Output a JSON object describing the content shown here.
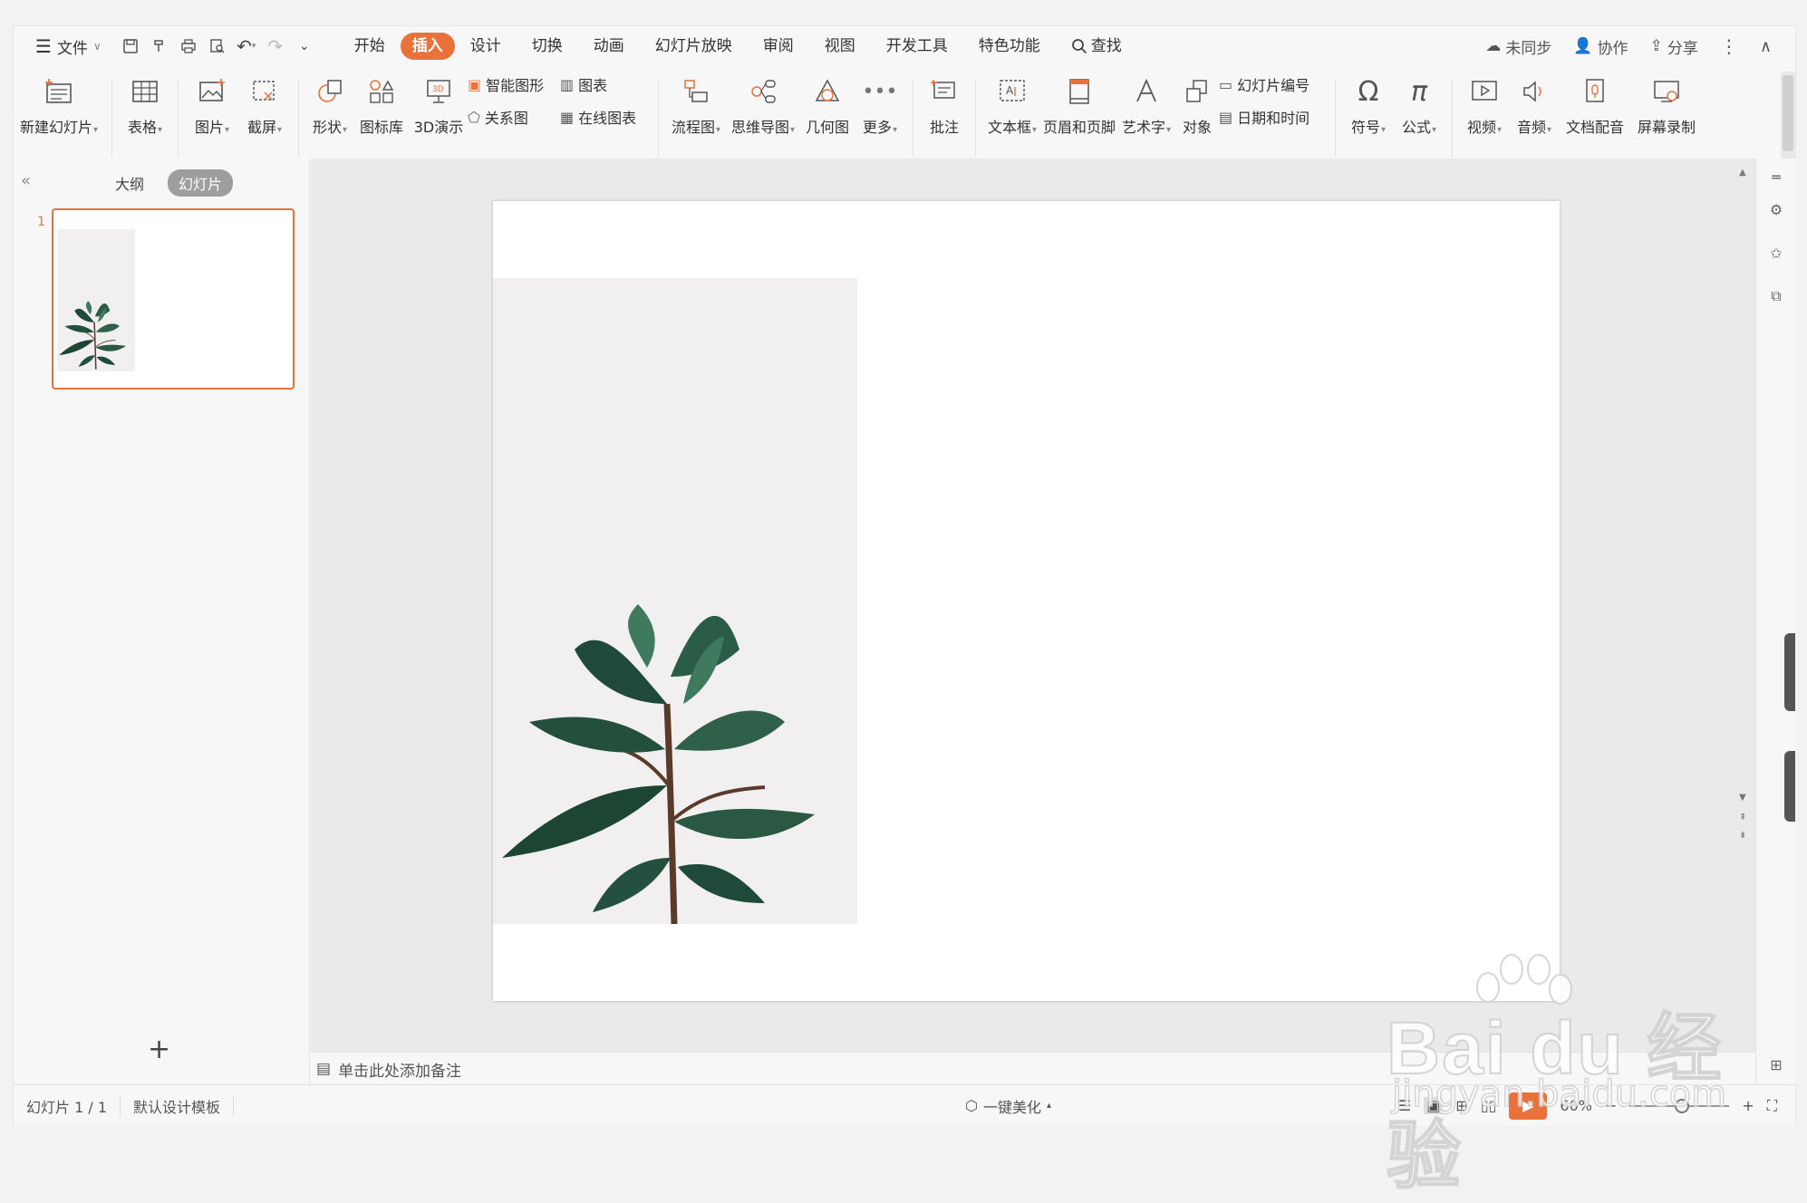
{
  "menu": {
    "file_label": "文件",
    "tabs": [
      "开始",
      "插入",
      "设计",
      "切换",
      "动画",
      "幻灯片放映",
      "审阅",
      "视图",
      "开发工具",
      "特色功能"
    ],
    "active_tab": "插入",
    "search_label": "查找",
    "right": {
      "sync": "未同步",
      "collab": "协作",
      "share": "分享"
    }
  },
  "ribbon": {
    "new_slide": "新建幻灯片",
    "table": "表格",
    "picture": "图片",
    "screenshot": "截屏",
    "shape": "形状",
    "icon_lib": "图标库",
    "demo3d": "3D演示",
    "smart_shape": "智能图形",
    "chart": "图表",
    "relation": "关系图",
    "online_chart": "在线图表",
    "flowchart": "流程图",
    "mindmap": "思维导图",
    "geometry": "几何图",
    "more": "更多",
    "comment": "批注",
    "textbox": "文本框",
    "header_footer": "页眉和页脚",
    "wordart": "艺术字",
    "object": "对象",
    "slide_number": "幻灯片编号",
    "datetime": "日期和时间",
    "symbol": "符号",
    "formula": "公式",
    "video": "视频",
    "audio": "音频",
    "doc_dub": "文档配音",
    "screen_rec": "屏幕录制"
  },
  "pane": {
    "outline": "大纲",
    "slides": "幻灯片",
    "slide_index": "1"
  },
  "notes_placeholder": "单击此处添加备注",
  "status": {
    "slide_info": "幻灯片 1 / 1",
    "template": "默认设计模板",
    "beautify": "一键美化",
    "zoom": "60%"
  },
  "watermark": {
    "brand": "Bai du 经验",
    "url": "jingyan.baidu.com"
  },
  "colors": {
    "accent": "#e9713a",
    "leaf_dark": "#1f4a3a",
    "leaf_light": "#3f7a5e"
  }
}
